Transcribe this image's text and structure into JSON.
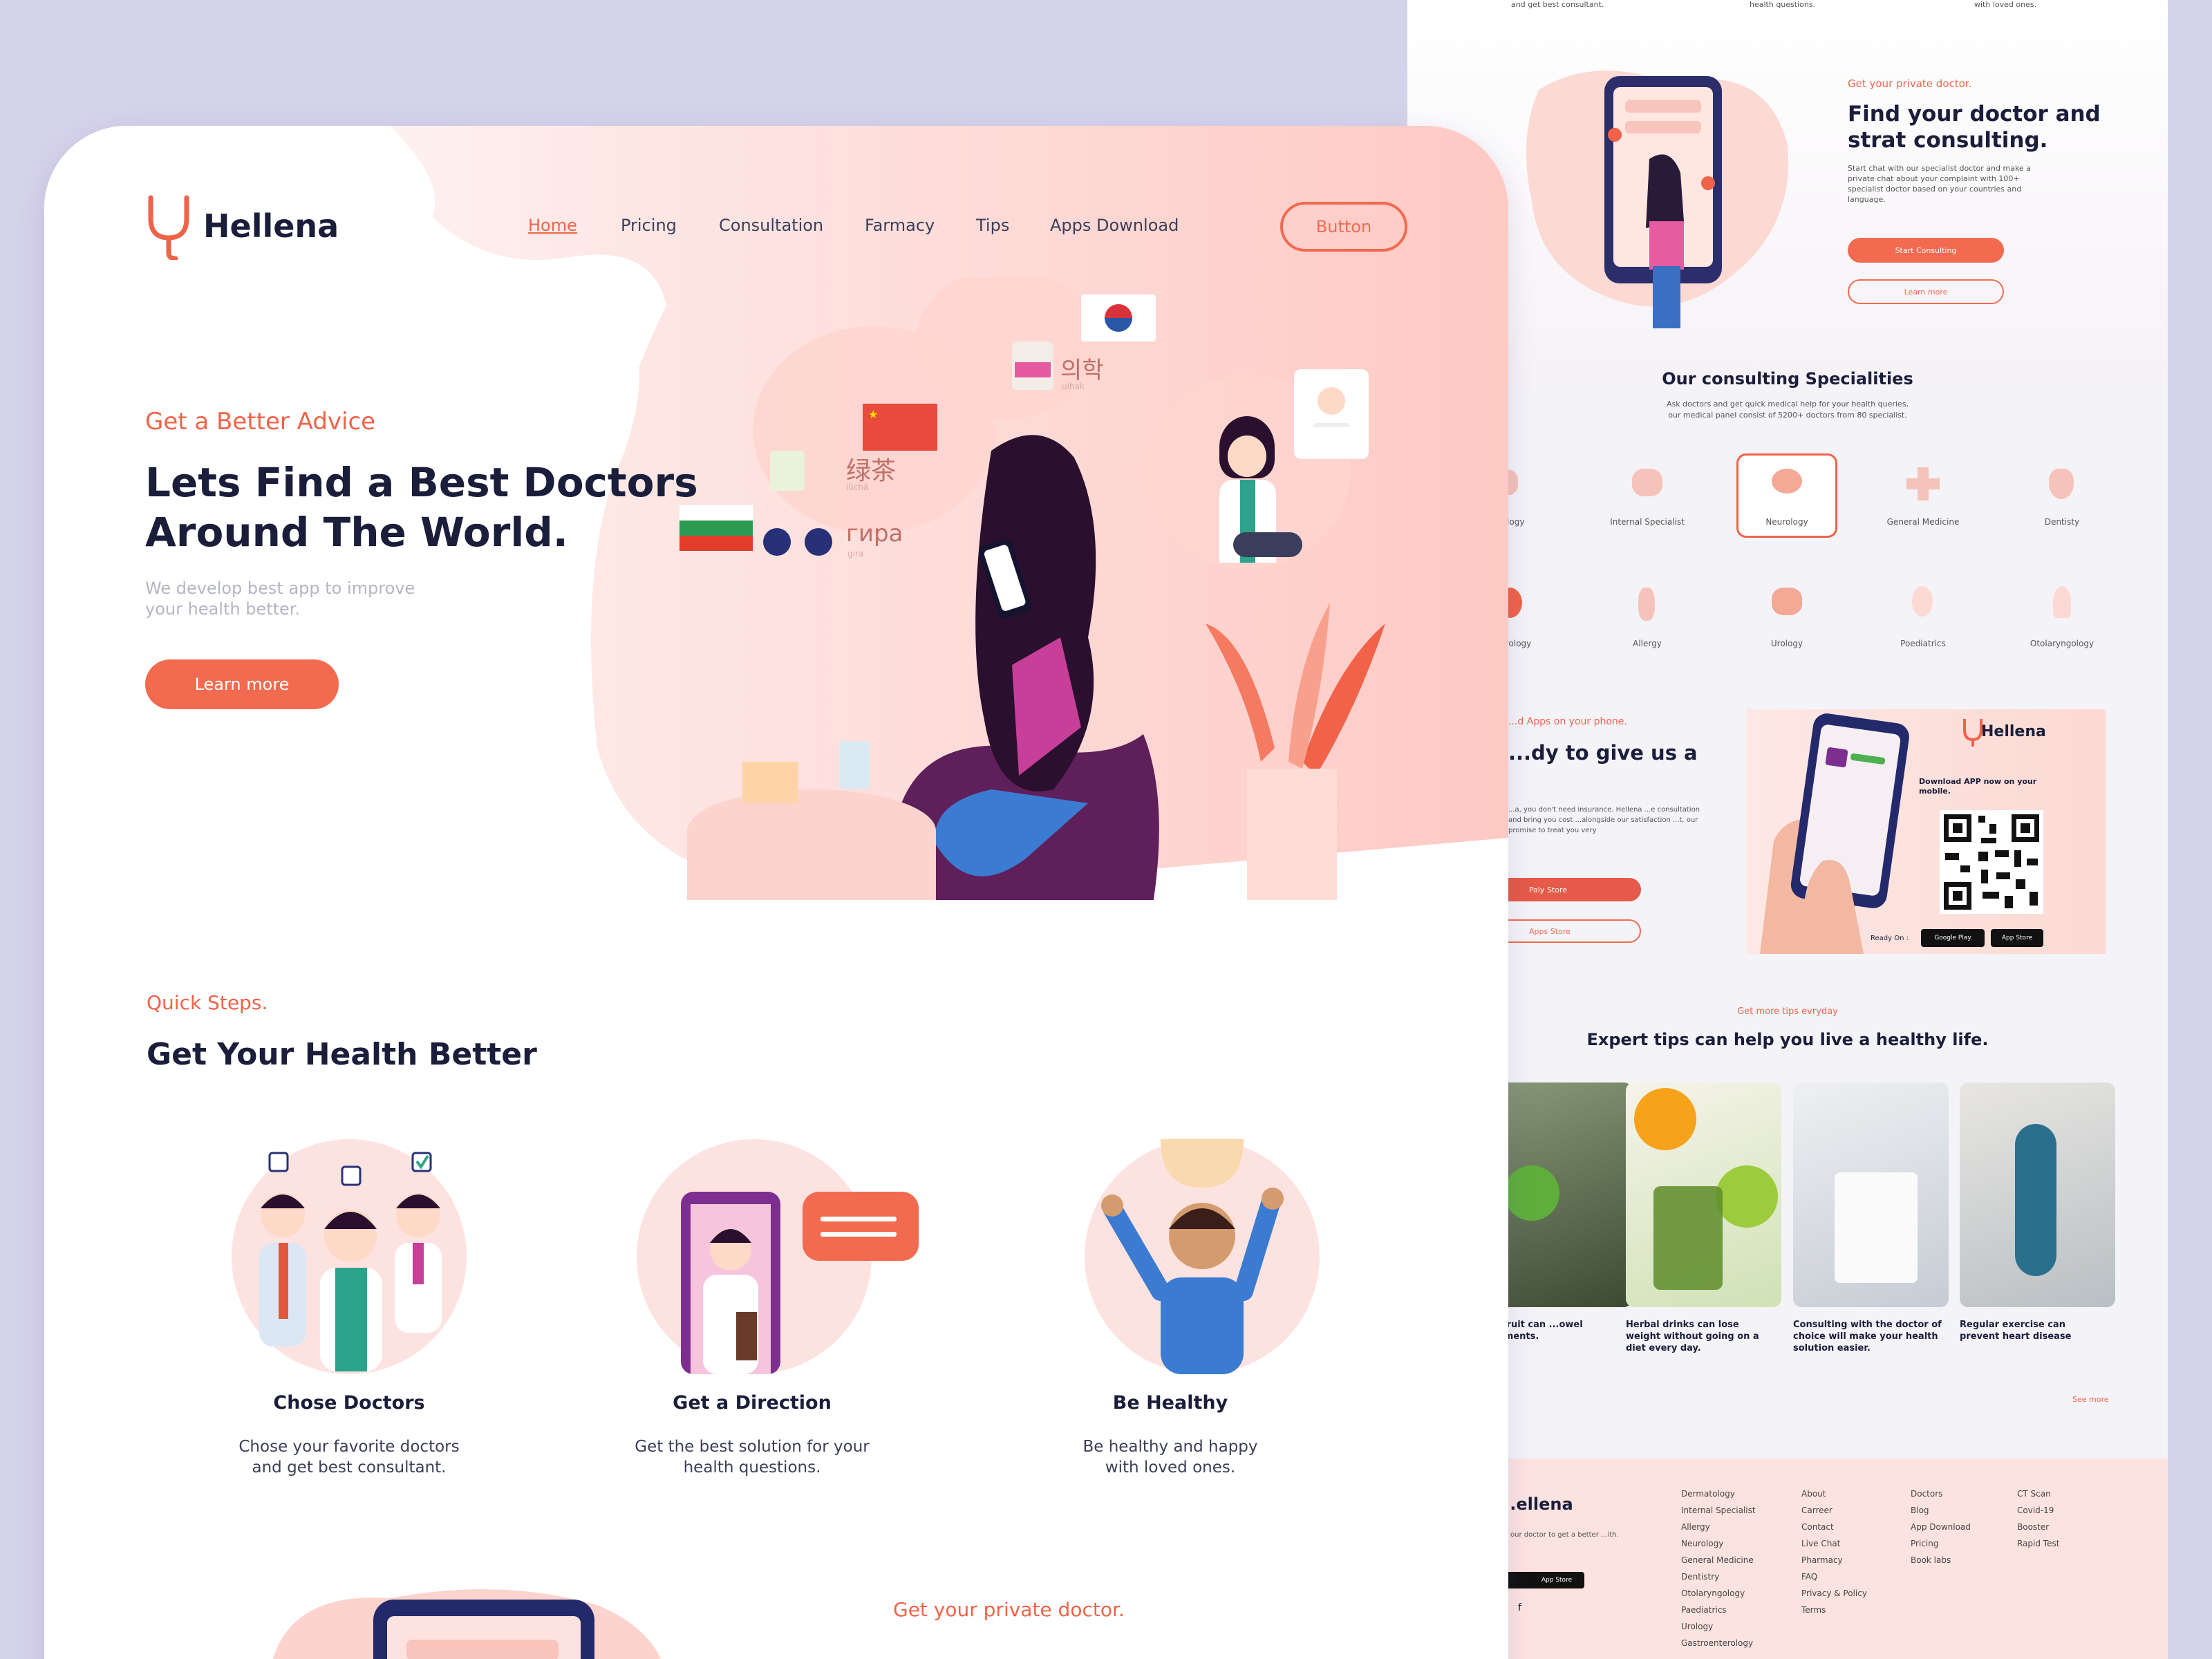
{
  "brand": "Hellena",
  "nav": {
    "items": [
      "Home",
      "Pricing",
      "Consultation",
      "Farmacy",
      "Tips",
      "Apps Download"
    ],
    "button": "Button"
  },
  "hero": {
    "eyebrow": "Get a Better Advice",
    "title_line1": "Lets Find a Best Doctors",
    "title_line2": "Around The World.",
    "subtitle_line1": "We develop best app to improve",
    "subtitle_line2": "your health better.",
    "cta": "Learn more",
    "bubbles": {
      "cn": "绿茶",
      "cn_sub": "lǜchá",
      "ru": "гира",
      "ru_sub": "gira",
      "kr": "의학",
      "kr_sub": "uihak"
    }
  },
  "steps": {
    "eyebrow": "Quick Steps.",
    "title": "Get Your Health Better",
    "items": [
      {
        "title": "Chose Doctors",
        "line1": "Chose your favorite doctors",
        "line2": "and get best consultant."
      },
      {
        "title": "Get a Direction",
        "line1": "Get the best solution for your",
        "line2": "health questions."
      },
      {
        "title": "Be Healthy",
        "line1": "Be healthy and happy",
        "line2": "with loved ones."
      }
    ]
  },
  "private_front": {
    "eyebrow": "Get your private doctor."
  },
  "back": {
    "top_snippets": [
      "and get best consultant.",
      "health questions.",
      "with loved ones."
    ],
    "private": {
      "eyebrow": "Get your private doctor.",
      "title_line1": "Find your doctor and",
      "title_line2": "strat consulting.",
      "body": "Start chat with our specialist doctor and make a private chat about your complaint with 100+ specialist doctor based on your countries and language.",
      "primary": "Start Consulting",
      "secondary": "Learn more"
    },
    "specialities": {
      "title": "Our consulting Specialities",
      "sub1": "Ask doctors and get quick medical help for your health queries,",
      "sub2": "our medical panel consist of 5200+ doctors from 80 specialist.",
      "row1": [
        "...tology",
        "Internal Specialist",
        "Neurology",
        "General Medicine",
        "Dentisty"
      ],
      "row2": [
        "...nterology",
        "Allergy",
        "Urology",
        "Poediatrics",
        "Otolaryngology"
      ]
    },
    "apps": {
      "eyebrow": "...d Apps on your phone.",
      "title": "...dy to give us a",
      "body": "...a, you don't need insurance. Hellena ...e consultation and bring you cost ...alongside our satisfaction ...t, our promise to treat you very",
      "btn1": "Paly Store",
      "btn2": "Apps Store",
      "card_brand": "Hellena",
      "card_text": "Download APP now on your mobile.",
      "ready": "Ready On :",
      "gp": "Google Play",
      "as": "App Store"
    },
    "tips": {
      "eyebrow": "Get more tips evryday",
      "title": "Expert tips can help you live a healthy life.",
      "captions": [
        "...ng fruit can ...owel movements.",
        "Herbal drinks can lose weight without going on a diet every day.",
        "Consulting with the doctor of choice will make your health solution easier.",
        "Regular exercise can prevent heart disease"
      ],
      "see_more": "See more"
    },
    "footer": {
      "brand": "...ellena",
      "tagline": "...h our doctor to get a better ...ith.",
      "col1": [
        "Dermatology",
        "Internal Specialist",
        "Allergy",
        "Neurology",
        "General Medicine",
        "Dentistry",
        "Otolaryngology",
        "Paediatrics",
        "Urology",
        "Gastroenterology"
      ],
      "col2": [
        "About",
        "Carreer",
        "Contact",
        "Live Chat",
        "Pharmacy",
        "FAQ",
        "Privacy & Policy",
        "Terms"
      ],
      "col3": [
        "Doctors",
        "Blog",
        "App Download",
        "Pricing",
        "Book labs"
      ],
      "col4": [
        "CT Scan",
        "Covid-19",
        "Booster",
        "Rapid Test"
      ]
    }
  },
  "colors": {
    "accent": "#f26a4f",
    "navy": "#1a1e3b",
    "pink": "#fde3e0",
    "bg": "#d5d3ea"
  }
}
